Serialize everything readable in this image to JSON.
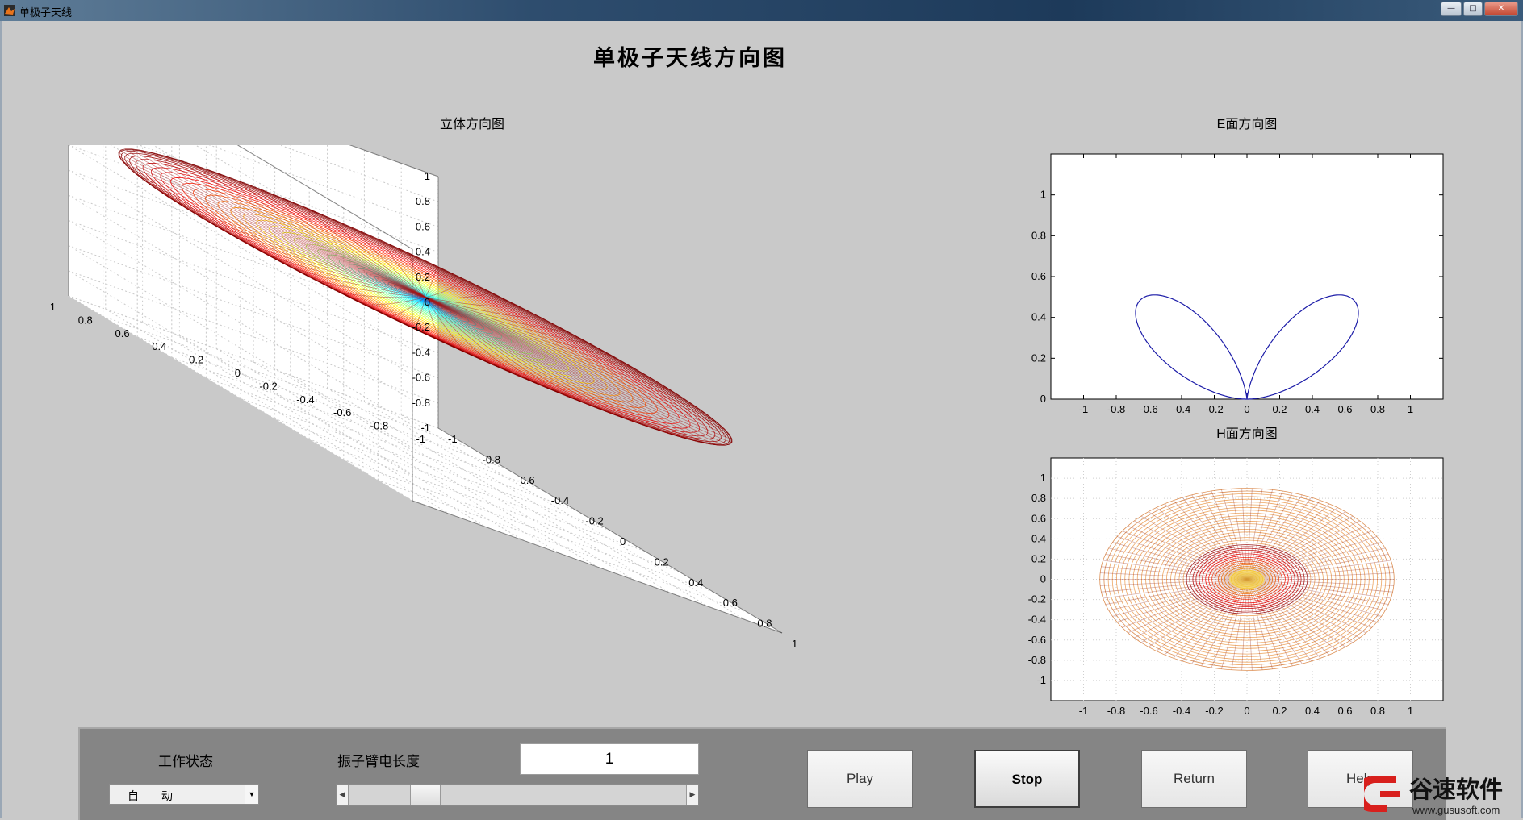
{
  "window": {
    "title": "单极子天线",
    "controls": [
      "—",
      "□",
      "✕"
    ]
  },
  "figure": {
    "main_title": "单极子天线方向图"
  },
  "axes_3d": {
    "title": "立体方向图",
    "z_ticks": [
      "1",
      "0.8",
      "0.6",
      "0.4",
      "0.2",
      "0",
      "-0.2",
      "-0.4",
      "-0.6",
      "-0.8",
      "-1"
    ],
    "y_ticks": [
      "1",
      "0.8",
      "0.6",
      "0.4",
      "0.2",
      "0",
      "-0.2",
      "-0.4",
      "-0.6",
      "-0.8",
      "-1"
    ],
    "x_ticks": [
      "-1",
      "-0.8",
      "-0.6",
      "-0.4",
      "-0.2",
      "0",
      "0.2",
      "0.4",
      "0.6",
      "0.8",
      "1"
    ]
  },
  "axes_e": {
    "title": "E面方向图",
    "y_ticks": [
      "1",
      "0.8",
      "0.6",
      "0.4",
      "0.2",
      "0"
    ],
    "x_ticks": [
      "-1",
      "-0.8",
      "-0.6",
      "-0.4",
      "-0.2",
      "0",
      "0.2",
      "0.4",
      "0.6",
      "0.8",
      "1"
    ]
  },
  "axes_h": {
    "title": "H面方向图",
    "y_ticks": [
      "1",
      "0.8",
      "0.6",
      "0.4",
      "0.2",
      "0",
      "-0.2",
      "-0.4",
      "-0.6",
      "-0.8",
      "-1"
    ],
    "x_ticks": [
      "-1",
      "-0.8",
      "-0.6",
      "-0.4",
      "-0.2",
      "0",
      "0.2",
      "0.4",
      "0.6",
      "0.8",
      "1"
    ]
  },
  "controls": {
    "mode_label": "工作状态",
    "mode_value": "自 动",
    "length_label": "振子臂电长度",
    "length_value": "1",
    "slider_fraction": 0.2,
    "buttons": [
      "Play",
      "Stop",
      "Return",
      "Help"
    ]
  },
  "watermark": {
    "brand": "谷速软件",
    "url": "www.gususoft.com"
  },
  "colors": {
    "figure_bg": "#c9c9c9",
    "panel_bg": "#858585",
    "e_plane_line": "#1c1ca8",
    "mesh_outer": "#b01010",
    "h_outer": "#e07a1a",
    "watermark_red": "#d8201d"
  }
}
